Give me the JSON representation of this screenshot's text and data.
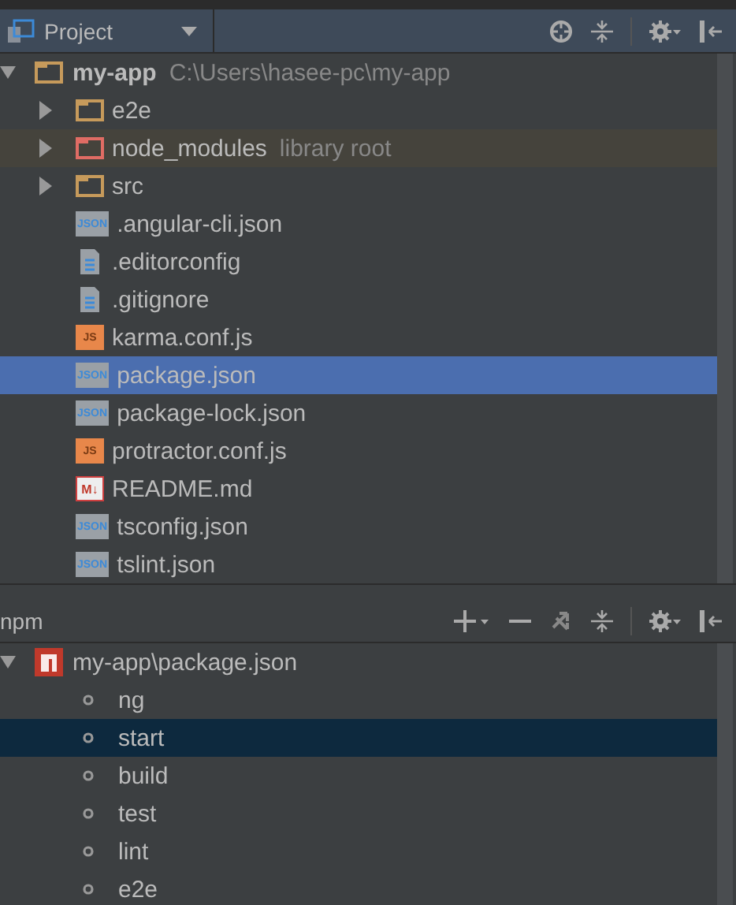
{
  "project_panel": {
    "title": "Project",
    "tree": [
      {
        "kind": "folder",
        "label": "my-app",
        "note": "C:\\Users\\hasee-pc\\my-app",
        "expanded": true,
        "selected": false,
        "children": [
          {
            "kind": "folder",
            "label": "e2e",
            "expanded": false,
            "selected": false
          },
          {
            "kind": "library",
            "label": "node_modules",
            "note": "library root",
            "expanded": false,
            "selected": false
          },
          {
            "kind": "folder",
            "label": "src",
            "expanded": false,
            "selected": false
          },
          {
            "kind": "json",
            "badge": "JSON",
            "label": ".angular-cli.json",
            "selected": false
          },
          {
            "kind": "text",
            "label": ".editorconfig",
            "selected": false
          },
          {
            "kind": "text",
            "label": ".gitignore",
            "selected": false
          },
          {
            "kind": "js",
            "badge": "JS",
            "label": "karma.conf.js",
            "selected": false
          },
          {
            "kind": "json",
            "badge": "JSON",
            "label": "package.json",
            "selected": true
          },
          {
            "kind": "json",
            "badge": "JSON",
            "label": "package-lock.json",
            "selected": false
          },
          {
            "kind": "js",
            "badge": "JS",
            "label": "protractor.conf.js",
            "selected": false
          },
          {
            "kind": "markdown",
            "badge": "M↓",
            "label": "README.md",
            "selected": false
          },
          {
            "kind": "json",
            "badge": "JSON",
            "label": "tsconfig.json",
            "selected": false
          },
          {
            "kind": "json",
            "badge": "JSON",
            "label": "tslint.json",
            "selected": false
          }
        ]
      }
    ]
  },
  "npm_panel": {
    "title": "npm",
    "root": {
      "label": "my-app\\package.json",
      "expanded": true
    },
    "scripts": [
      {
        "label": "ng",
        "selected": false
      },
      {
        "label": "start",
        "selected": true
      },
      {
        "label": "build",
        "selected": false
      },
      {
        "label": "test",
        "selected": false
      },
      {
        "label": "lint",
        "selected": false
      },
      {
        "label": "e2e",
        "selected": false
      }
    ]
  }
}
